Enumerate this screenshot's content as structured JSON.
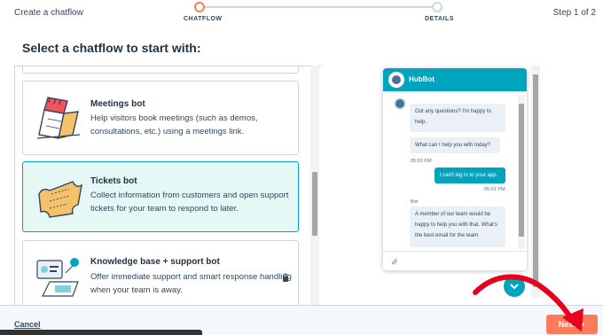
{
  "topbar": {
    "title": "Create a chatflow",
    "step_indicator": "Step 1 of 2",
    "steps": [
      {
        "label": "CHATFLOW",
        "state": "active"
      },
      {
        "label": "DETAILS",
        "state": "inactive"
      }
    ]
  },
  "heading": "Select a chatflow to start with:",
  "cards": [
    {
      "name": "Meetings bot",
      "description": "Help visitors book meetings (such as demos, consultations, etc.) using a meetings link.",
      "icon": "calendar-illustration-icon",
      "selected": false
    },
    {
      "name": "Tickets bot",
      "description": "Collect information from customers and open support tickets for your team to respond to later.",
      "icon": "ticket-illustration-icon",
      "selected": true
    },
    {
      "name": "Knowledge base + support bot",
      "description": "Offer immediate support and smart response handling when your team is away.",
      "icon": "knowledge-base-illustration-icon",
      "locked": true,
      "selected": false
    }
  ],
  "chat_preview": {
    "bot_name": "HubBot",
    "messages": [
      {
        "from": "bot",
        "text": "Got any questions? I'm happy to help."
      },
      {
        "from": "bot",
        "text": "What can I help you with today?"
      },
      {
        "time": "05:01 PM"
      },
      {
        "from": "user",
        "text": "I can't log in to your app."
      },
      {
        "time": "05:01 PM"
      },
      {
        "label": "Bot"
      },
      {
        "from": "bot",
        "text": "A member of our team would be happy to help you with that. What's the best email for the team"
      }
    ]
  },
  "footer": {
    "cancel_label": "Cancel",
    "next_label": "Next"
  },
  "colors": {
    "accent": "#ff7a59",
    "teal": "#00a4bd",
    "selected_bg": "#e5f8f6",
    "annotation": "#e8001c"
  }
}
